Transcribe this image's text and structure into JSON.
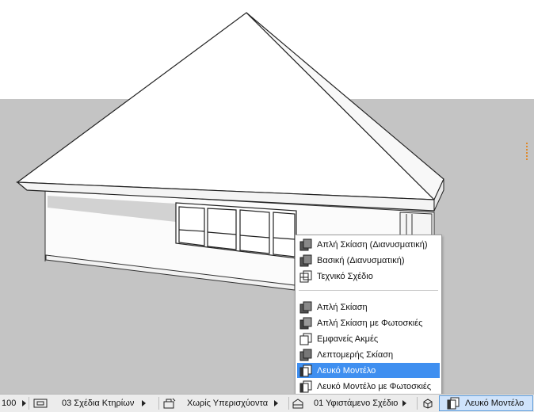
{
  "menu": {
    "items": [
      {
        "label": "Απλή Σκίαση (Διανυσματική)",
        "icon": "shaded-block-icon"
      },
      {
        "label": "Βασική (Διανυσματική)",
        "icon": "shaded-block-icon"
      },
      {
        "label": "Τεχνικό Σχέδιο",
        "icon": "wireframe-block-icon"
      },
      {
        "label": "Απλή Σκίαση",
        "icon": "shaded-block-icon"
      },
      {
        "label": "Απλή Σκίαση με Φωτοσκιές",
        "icon": "shaded-block-icon"
      },
      {
        "label": "Εμφανείς Ακμές",
        "icon": "edges-block-icon"
      },
      {
        "label": "Λεπτομερής Σκίαση",
        "icon": "shaded-block-icon"
      },
      {
        "label": "Λευκό Μοντέλο",
        "icon": "white-model-icon",
        "selected": true
      },
      {
        "label": "Λευκό Μοντέλο με Φωτοσκιές",
        "icon": "white-model-icon"
      }
    ]
  },
  "statusbar": {
    "zoom": "100",
    "layout_book": "03 Σχέδια Κτηρίων",
    "renovation": "Χωρίς Υπερισχύοντα",
    "structure": "01 Υφιστάμενο Σχέδιο",
    "visual_style": "Λευκό Μοντέλο"
  },
  "colors": {
    "background": "#c4c4c4",
    "selection": "#3f8ff0",
    "active_field": "#cfe3fb"
  }
}
